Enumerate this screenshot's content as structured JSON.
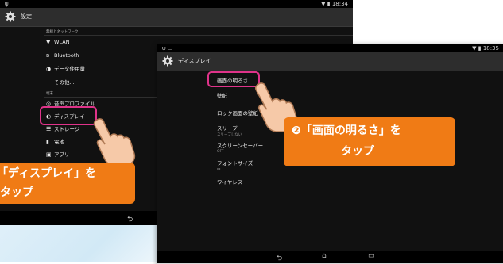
{
  "colors": {
    "accent": "#33b5e5",
    "highlight": "#e0338a",
    "callout": "#f07b15",
    "background": "#111111"
  },
  "back_screen": {
    "status_time": "18:34",
    "title": "設定",
    "section_wireless": "無線とネットワーク",
    "wireless_items": [
      {
        "icon": "wifi-icon",
        "label": "WLAN"
      },
      {
        "icon": "bluetooth-icon",
        "label": "Bluetooth"
      },
      {
        "icon": "data-usage-icon",
        "label": "データ使用量"
      },
      {
        "icon": "",
        "label": "その他..."
      }
    ],
    "wlan_toggle": "ON",
    "section_device": "端末",
    "device_items": [
      {
        "icon": "profile-icon",
        "label": "音声プロファイル"
      },
      {
        "icon": "display-icon",
        "label": "ディスプレイ"
      },
      {
        "icon": "storage-icon",
        "label": "ストレージ"
      },
      {
        "icon": "battery-icon",
        "label": "電池"
      },
      {
        "icon": "apps-icon",
        "label": "アプリ"
      }
    ],
    "callout": {
      "line1": "「ディスプレイ」を",
      "line2": "タップ"
    }
  },
  "front_screen": {
    "status_time": "18:35",
    "title": "ディスプレイ",
    "items": [
      {
        "label": "画面の明るさ",
        "sub": ""
      },
      {
        "label": "壁紙",
        "sub": ""
      },
      {
        "label": "ロック画面の壁紙",
        "sub": ""
      },
      {
        "label": "スリープ",
        "sub": "スリープしない"
      },
      {
        "label": "スクリーンセーバー",
        "sub": "OFF"
      },
      {
        "label": "フォントサイズ",
        "sub": "中"
      },
      {
        "label": "ワイヤレス",
        "sub": ""
      }
    ],
    "callout": {
      "number": "❷",
      "line1": "「画面の明るさ」を",
      "line2": "タップ"
    }
  }
}
